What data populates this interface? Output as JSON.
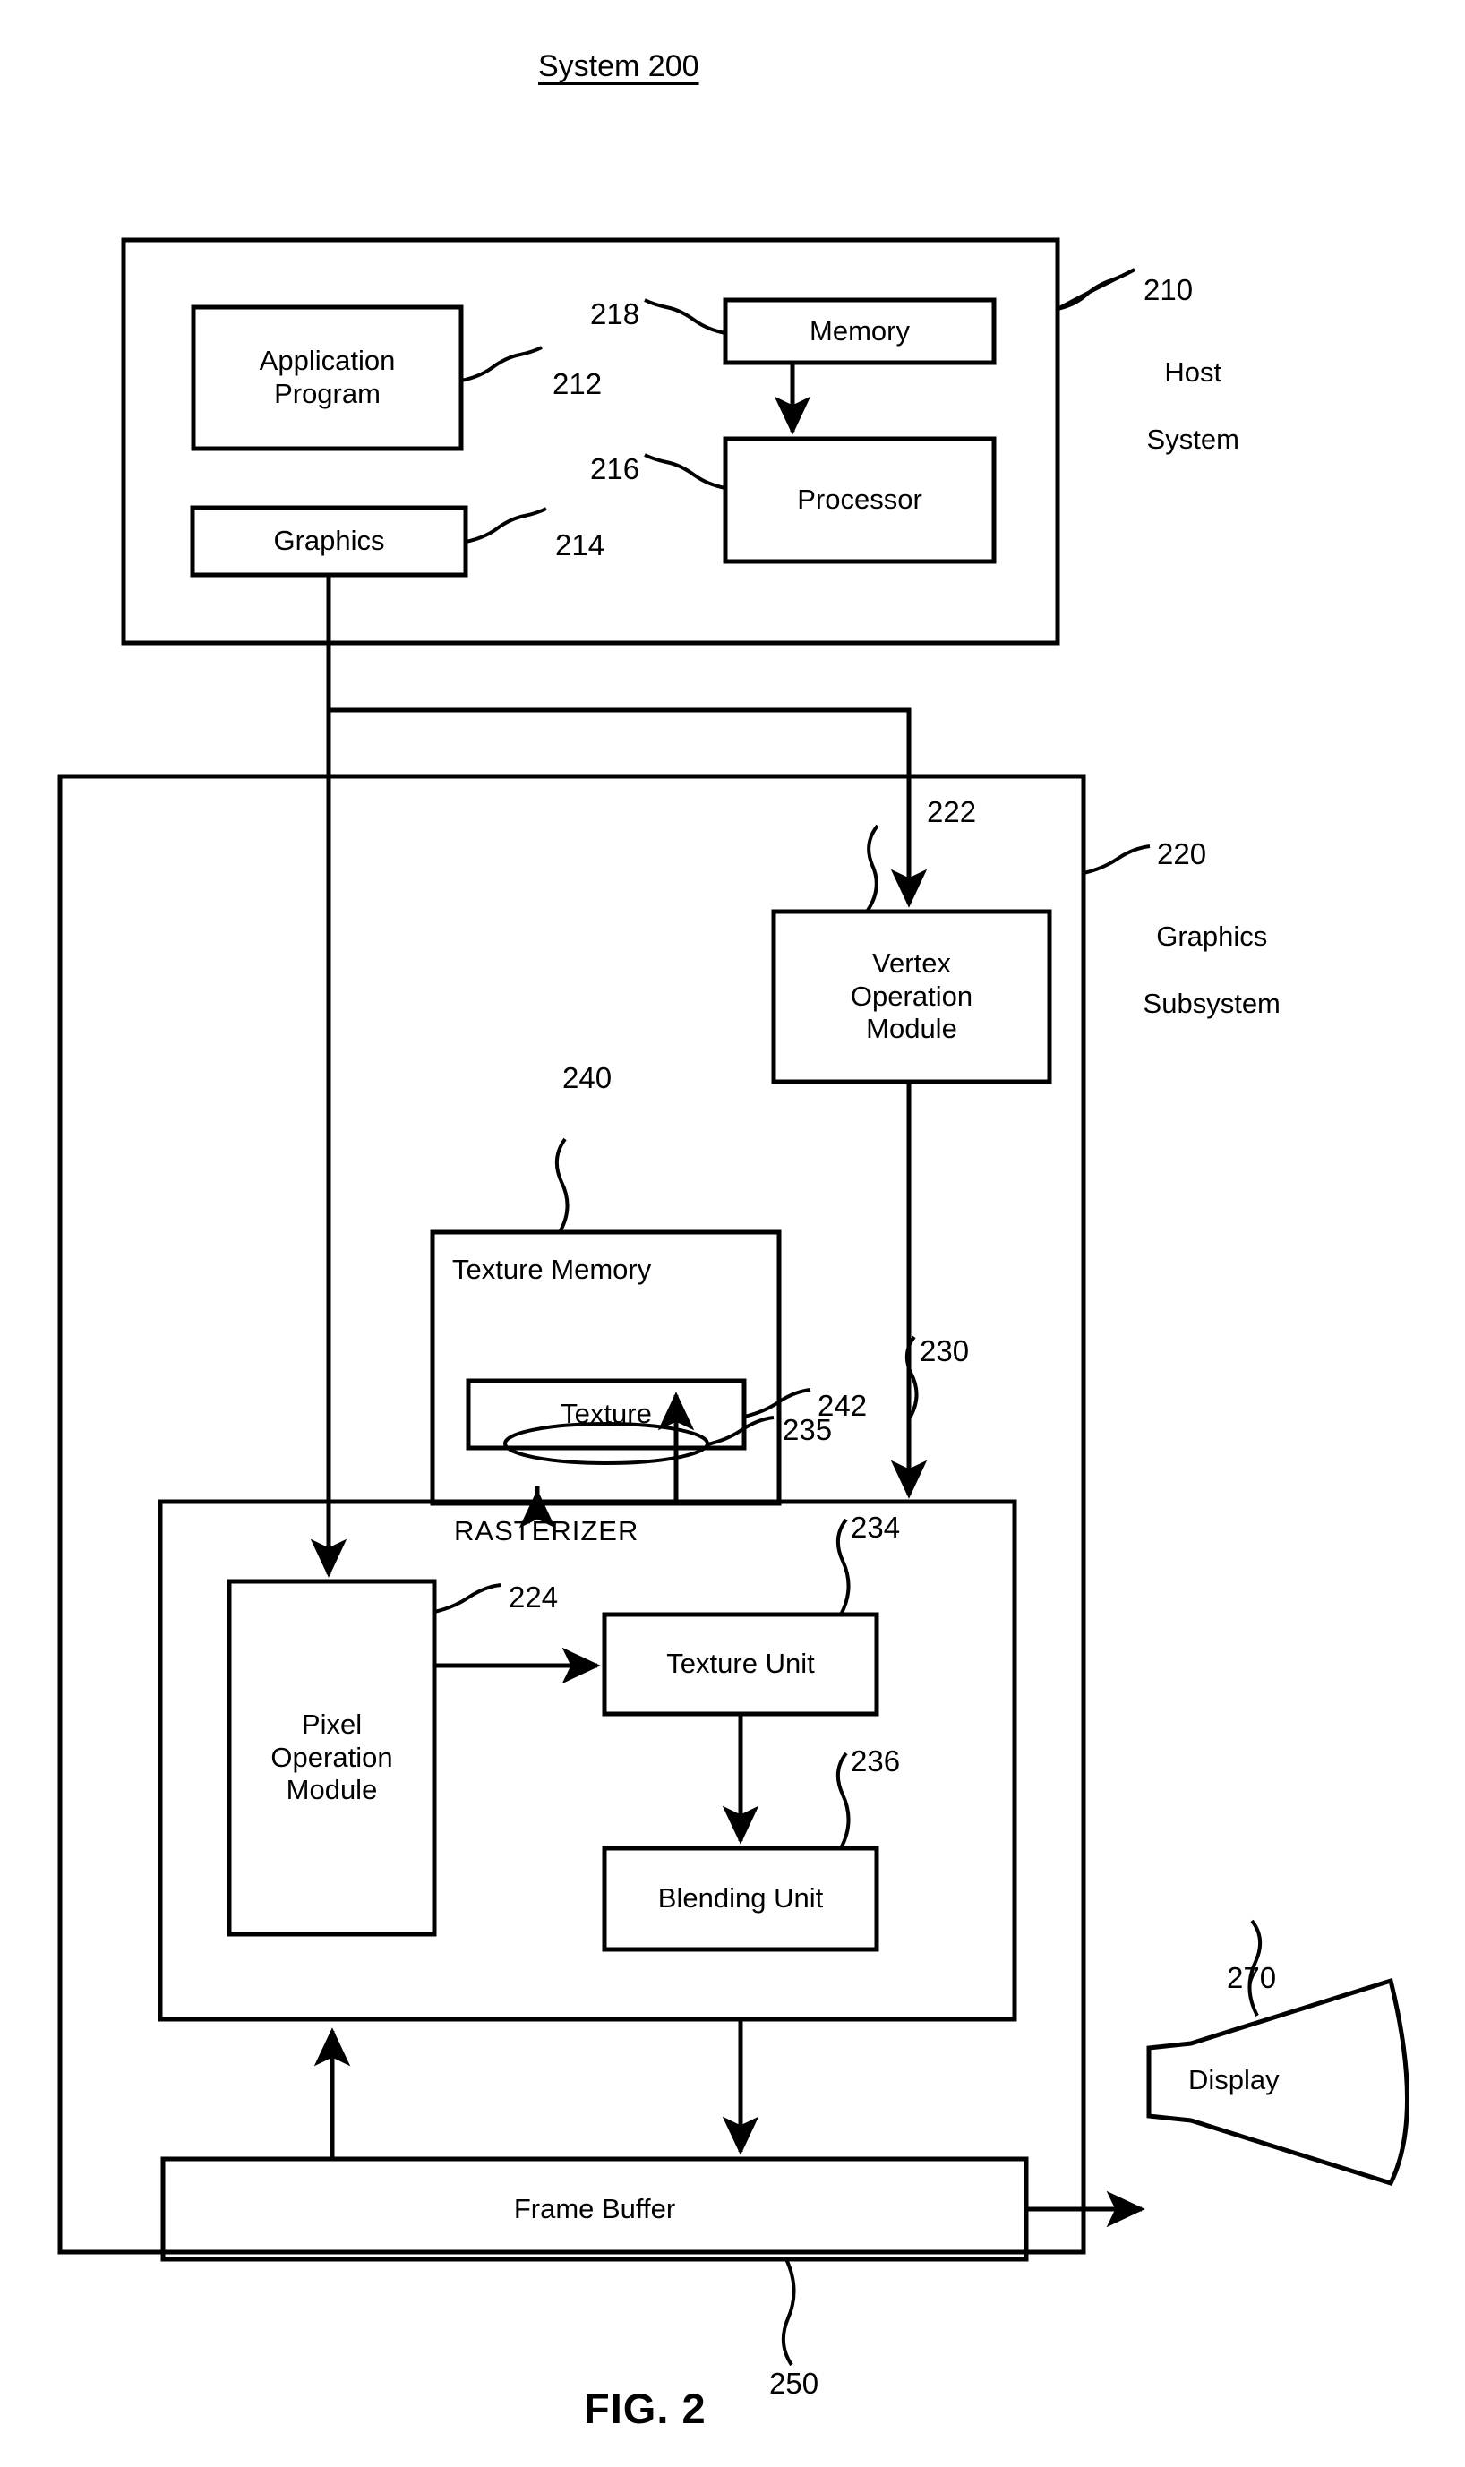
{
  "figure": {
    "title": "System 200",
    "caption": "FIG. 2"
  },
  "host_system": {
    "ref": "210",
    "label_line1": "Host",
    "label_line2": "System",
    "blocks": [
      {
        "name": "application-program",
        "label": "Application\nProgram",
        "ref": "212"
      },
      {
        "name": "graphics",
        "label": "Graphics",
        "ref": "214"
      },
      {
        "name": "memory",
        "label": "Memory",
        "ref": "218"
      },
      {
        "name": "processor",
        "label": "Processor",
        "ref": "216"
      }
    ]
  },
  "graphics_subsystem": {
    "ref": "220",
    "label_line1": "Graphics",
    "label_line2": "Subsystem",
    "blocks": [
      {
        "name": "vertex-operation-module",
        "label": "Vertex\nOperation\nModule",
        "ref": "222"
      },
      {
        "name": "texture-memory",
        "label": "Texture Memory",
        "ref": "240"
      },
      {
        "name": "texture",
        "label": "Texture",
        "ref": "242"
      },
      {
        "name": "bus-235",
        "label": "",
        "ref": "235"
      },
      {
        "name": "rasterizer",
        "label": "RASTERIZER",
        "ref": "230"
      },
      {
        "name": "pixel-operation-module",
        "label": "Pixel\nOperation\nModule",
        "ref": "224"
      },
      {
        "name": "texture-unit",
        "label": "Texture Unit",
        "ref": "234"
      },
      {
        "name": "blending-unit",
        "label": "Blending Unit",
        "ref": "236"
      },
      {
        "name": "frame-buffer",
        "label": "Frame Buffer",
        "ref": "250"
      }
    ]
  },
  "display": {
    "name": "display",
    "label": "Display",
    "ref": "270"
  },
  "style": {
    "line_color": "#000000",
    "background": "#ffffff"
  }
}
